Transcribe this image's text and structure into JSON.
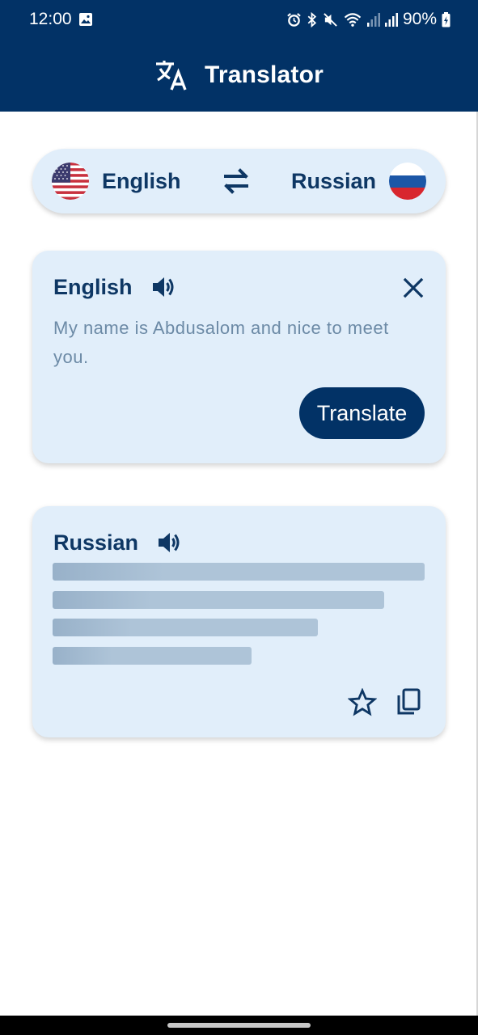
{
  "status": {
    "time": "12:00",
    "battery": "90%",
    "icons": [
      "image-icon",
      "alarm-icon",
      "bluetooth-icon",
      "mute-icon",
      "wifi-icon",
      "signal-icon",
      "signal-icon",
      "battery-charging-icon"
    ]
  },
  "app": {
    "title": "Translator",
    "logo_icon": "translate-icon"
  },
  "language_bar": {
    "source": {
      "name": "English",
      "flag": "us-flag-icon"
    },
    "target": {
      "name": "Russian",
      "flag": "ru-flag-icon"
    },
    "swap_icon": "swap-arrows-icon"
  },
  "source_card": {
    "language": "English",
    "text": "My name is Abdusalom and nice to meet you.",
    "translate_label": "Translate",
    "speaker_icon": "volume-icon",
    "clear_icon": "close-icon"
  },
  "target_card": {
    "language": "Russian",
    "state": "loading",
    "speaker_icon": "volume-icon",
    "favorite_icon": "star-outline-icon",
    "copy_icon": "copy-icon",
    "skeleton_line_widths": [
      1.0,
      0.89,
      0.71,
      0.535
    ]
  },
  "colors": {
    "primary": "#023266",
    "card_background": "#e1eefa",
    "text_dark": "#0e3764",
    "text_muted": "#6c8aa6"
  }
}
